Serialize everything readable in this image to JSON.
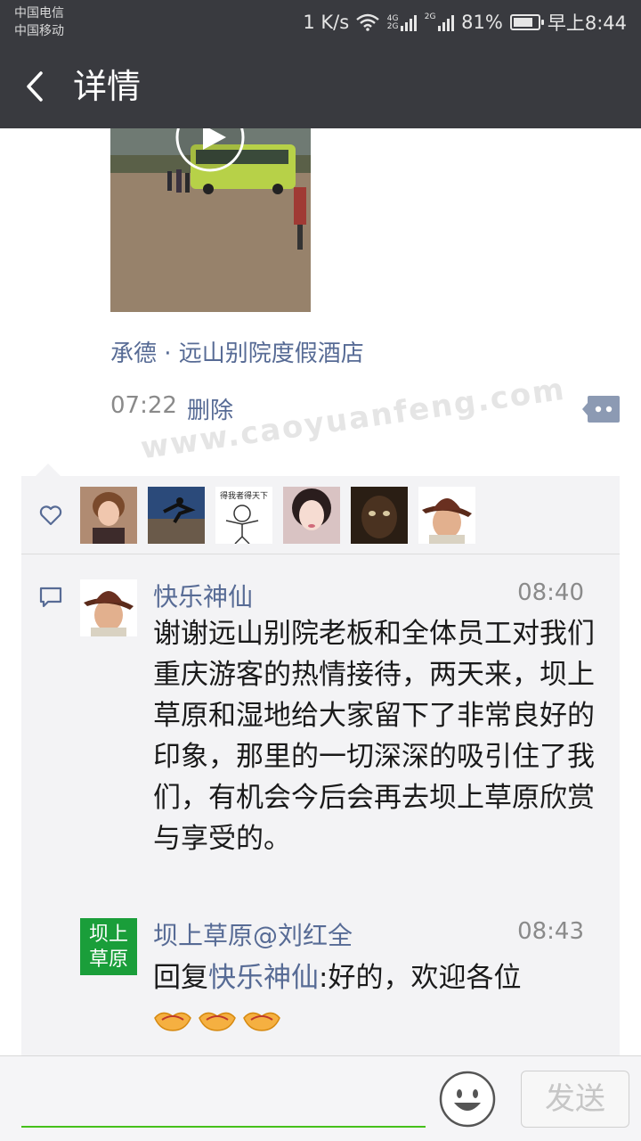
{
  "status_bar": {
    "carrier_1": "中国电信",
    "carrier_2": "中国移动",
    "speed": "1 K/s",
    "net_1": "4G",
    "net_1b": "2G",
    "net_2": "2G",
    "battery": "81%",
    "battery_level": 0.81,
    "time": "早上8:44"
  },
  "header": {
    "title": "详情",
    "back_icon": "chevron-left-icon"
  },
  "post": {
    "location": "承德 · 远山别院度假酒店",
    "time": "07:22",
    "delete_label": "删除",
    "watermark": "www.caoyuanfeng.com"
  },
  "likes": {
    "icon": "heart-outline-icon",
    "avatars": [
      {
        "label": ""
      },
      {
        "label": ""
      },
      {
        "label": "得我者得天下"
      },
      {
        "label": ""
      },
      {
        "label": ""
      },
      {
        "label": ""
      }
    ]
  },
  "comments": [
    {
      "name": "快乐神仙",
      "time": "08:40",
      "text": "谢谢远山别院老板和全体员工对我们重庆游客的热情接待，两天来，坝上草原和湿地给大家留下了非常良好的印象，那里的一切深深的吸引住了我们，有机会今后会再去坝上草原欣赏与享受的。"
    },
    {
      "name": "坝上草原@刘红全",
      "avatar_line_1": "坝上",
      "avatar_line_2": "草原",
      "time": "08:43",
      "reply_prefix": "回复",
      "reply_to": "快乐神仙",
      "text": ":好的，欢迎各位"
    }
  ],
  "input_bar": {
    "send_label": "发送"
  },
  "colors": {
    "bar": "#393a3f",
    "link": "#576b95",
    "accent_green": "#45c01a"
  }
}
